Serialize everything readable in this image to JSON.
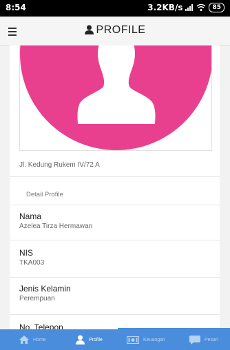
{
  "status_bar": {
    "time": "8:54",
    "network_speed": "3.2KB/s",
    "battery": "85"
  },
  "header": {
    "title": "PROFILE"
  },
  "profile": {
    "avatar_color": "#e8408f",
    "address": "Jl. Kedung Rukem IV/72 A",
    "section_title": "Detail Profile",
    "fields": [
      {
        "label": "Nama",
        "value": "Azelea Tirza Hermawan"
      },
      {
        "label": "NIS",
        "value": "TKA003"
      },
      {
        "label": "Jenis Kelamin",
        "value": "Perempuan"
      },
      {
        "label": "No. Telepon",
        "value": ""
      }
    ]
  },
  "bottom_nav": {
    "items": [
      {
        "label": "Home",
        "icon": "home-icon"
      },
      {
        "label": "Profile",
        "icon": "person-icon",
        "active": true
      },
      {
        "label": "Keuangan",
        "icon": "money-icon"
      },
      {
        "label": "Pesan",
        "icon": "chat-icon"
      }
    ]
  },
  "colors": {
    "accent": "#4a8ddc",
    "avatar": "#e8408f"
  }
}
